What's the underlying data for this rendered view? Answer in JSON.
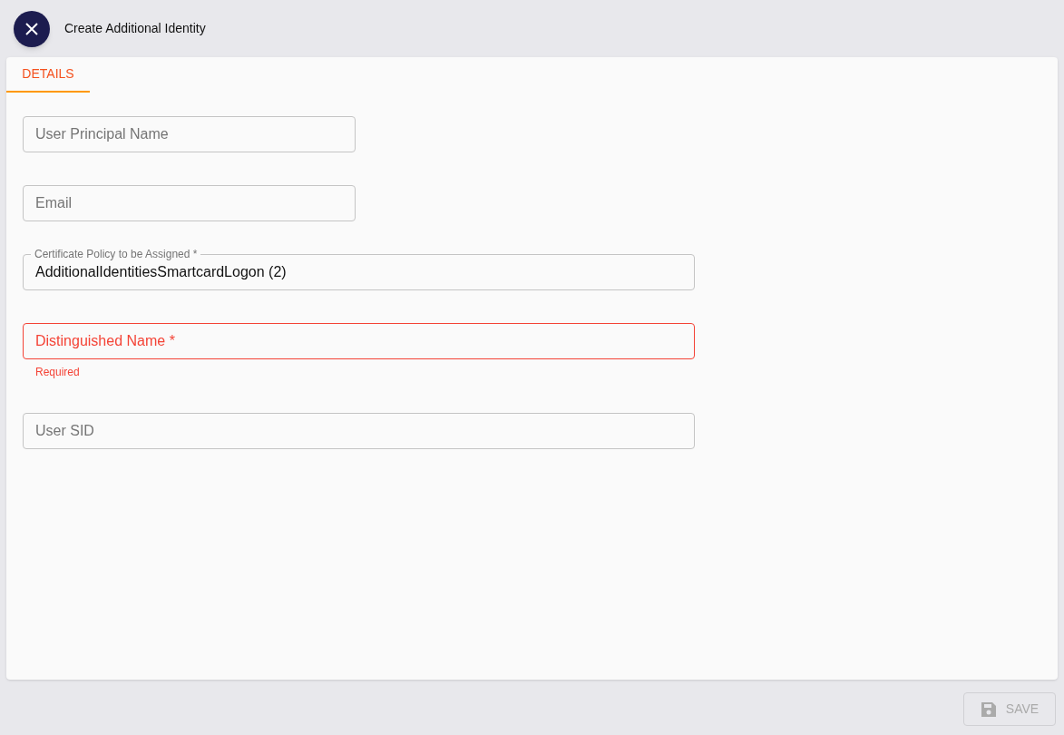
{
  "header": {
    "title": "Create Additional Identity"
  },
  "tabs": [
    {
      "label": "DETAILS",
      "selected": true
    }
  ],
  "fields": [
    {
      "label": "User Principal Name",
      "invalid": false
    },
    {
      "label": "Email",
      "invalid": false
    },
    {
      "label": "Certificate Policy to be Assigned *",
      "value": "AdditionalIdentitiesSmartcardLogon (2)",
      "invalid": false
    },
    {
      "label": "Distinguished Name *",
      "invalid": true,
      "helper_text": "Required"
    },
    {
      "label": "User SID",
      "invalid": false
    }
  ],
  "save_button": {
    "label": "SAVE",
    "disabled": true
  }
}
